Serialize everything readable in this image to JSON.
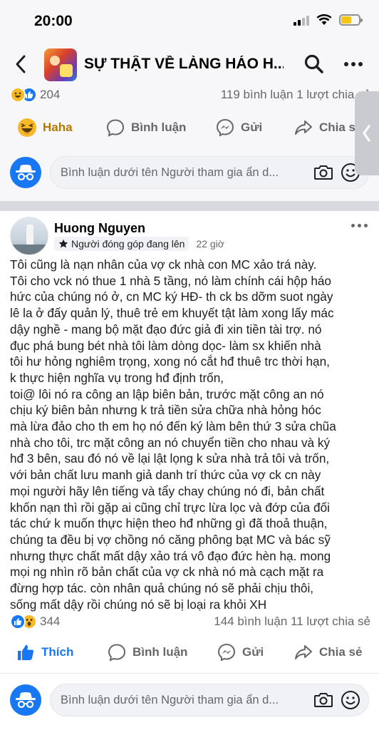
{
  "status_bar": {
    "time": "20:00"
  },
  "header": {
    "title": "SỰ THẬT VỀ LÀNG HÁO H..."
  },
  "top_post": {
    "reaction_count": "204",
    "comments_shares": "119 bình luận  1 lượt chia sẻ",
    "actions": {
      "reaction": "Haha",
      "comment": "Bình luận",
      "send": "Gửi",
      "share": "Chia sẻ"
    }
  },
  "comment_box": {
    "placeholder": "Bình luận dưới tên Người tham gia ẩn d..."
  },
  "post": {
    "author": "Huong Nguyen",
    "badge": "Người đóng góp đang lên",
    "time": "22 giờ",
    "lines": [
      "Tôi cũng là nạn nhân của vợ ck nhà con MC xảo trá này.",
      "Tôi cho vck nó thue 1 nhà 5 tầng, nó làm chính cái hộp háo",
      "hức của chúng nó ở, cn MC ký HĐ- th ck bs dỡm suot ngày",
      "lê la ở đấy quản lý, thuê trẻ em khuyết tật làm xong lấy mác",
      "dậy nghề - mang bộ mặt đạo đức giả đi xin tiền tài trợ.  nó",
      "đục phá bung bét nhà tôi làm dòng dọc- làm sx khiến nhà",
      "tôi hư hỏng nghiêm trọng, xong nó cắt hđ thuê trc thời hạn,",
      "k thực hiện nghĩa vụ trong hđ định trốn,",
      "toi@ lôi nó ra công an lập biên bản, trước mặt công an nó",
      "chịu ký biên bản nhưng k trả tiền sửa chữa nhà hỏng hóc",
      "mà lừa đảo cho th em họ nó đến ký làm bên thứ 3 sửa chũa",
      "nhà cho tôi, trc mặt công an nó chuyển tiền cho nhau và ký",
      "hđ 3 bên, sau đó nó về lại lật lọng k sửa nhà trả tôi và trốn,",
      "với bản chất lưu manh giả danh trí thức của vợ ck cn này",
      "mọi người hãy lên tiếng và tẩy chay chúng nó đi, bản chất",
      "khốn nạn thì rồi gặp ai cũng chỉ trực lừa lọc và đớp của đối",
      "tác chứ k muốn thực hiện theo hđ những gì đã thoả thuận,",
      "chúng ta đều bị vợ chồng nó căng phông bạt MC và bác sỹ",
      "nhưng thực chất mất dậy xảo trá vô đạo đức hèn hạ. mong",
      "mọi ng nhìn rõ bản chất của vợ ck nhà nó mà cạch mặt ra",
      "đừng hợp tác. còn nhân quả chúng nó sẽ phải chịu thôi,",
      "sống mất dậy rồi chúng nó sẽ bị loại ra khỏi XH"
    ],
    "reaction_count": "344",
    "comments_shares": "144 bình luận  11 lượt chia sẻ",
    "actions": {
      "reaction": "Thích",
      "comment": "Bình luận",
      "send": "Gửi",
      "share": "Chia sẻ"
    }
  },
  "icons": {
    "back": "chevron-left-icon",
    "search": "search-icon",
    "more": "more-dots-icon",
    "haha": "haha-emoji-icon",
    "like": "thumbs-up-icon",
    "wow": "wow-emoji-icon",
    "comment": "comment-bubble-icon",
    "messenger": "messenger-icon",
    "share": "share-arrow-icon",
    "camera": "camera-icon",
    "emoji": "smiley-icon",
    "anon": "anonymous-avatar-icon",
    "star": "star-badge-icon",
    "sidebar_tab": "chevron-left-tab-icon"
  },
  "colors": {
    "accent": "#1877f2",
    "haha": "#f7b928",
    "muted": "#65676b"
  }
}
